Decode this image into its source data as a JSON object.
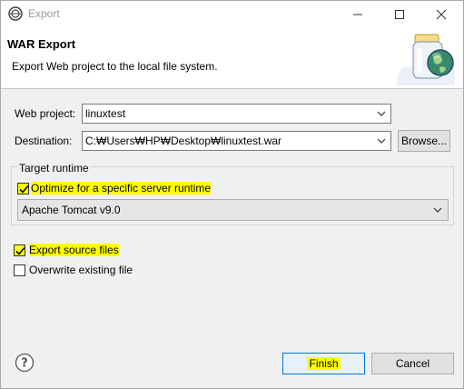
{
  "window": {
    "title": "Export"
  },
  "header": {
    "title": "WAR Export",
    "description": "Export Web project to the local file system."
  },
  "form": {
    "web_project_label": "Web project:",
    "web_project_value": "linuxtest",
    "destination_label": "Destination:",
    "destination_value": "C:₩Users₩HP₩Desktop₩linuxtest.war",
    "browse_label": "Browse..."
  },
  "target_runtime": {
    "title": "Target runtime",
    "optimize_label": "Optimize for a specific server runtime",
    "optimize_checked": true,
    "runtime_value": "Apache Tomcat v9.0"
  },
  "options": {
    "export_source_label": "Export source files",
    "export_source_checked": true,
    "overwrite_label": "Overwrite existing file",
    "overwrite_checked": false
  },
  "footer": {
    "finish_label": "Finish",
    "cancel_label": "Cancel"
  },
  "icons": {
    "app": "eclipse-icon",
    "help": "help-icon",
    "header": "war-jar-globe-icon"
  },
  "colors": {
    "highlight": "#ffff00",
    "globe": "#3a8a6a"
  }
}
